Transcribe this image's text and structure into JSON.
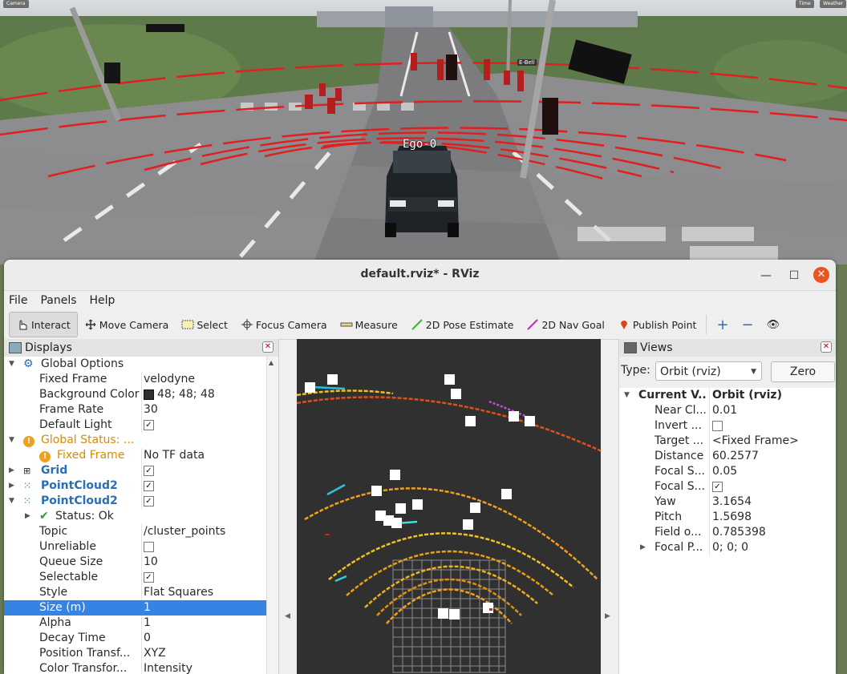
{
  "sim": {
    "tag_left": "Camera",
    "tag_right_1": "Time",
    "tag_right_2": "Weather",
    "ego_label": "Ego-0",
    "sign_label": "E-Bell"
  },
  "window": {
    "title": "default.rviz* - RViz",
    "minimize": "—",
    "maximize": "☐",
    "close": "✕"
  },
  "menu": {
    "file": "File",
    "panels": "Panels",
    "help": "Help"
  },
  "toolbar": {
    "interact": "Interact",
    "move_camera": "Move Camera",
    "select": "Select",
    "focus_camera": "Focus Camera",
    "measure": "Measure",
    "pose_estimate": "2D Pose Estimate",
    "nav_goal": "2D Nav Goal",
    "publish_point": "Publish Point",
    "add": "+",
    "remove": "−",
    "view": "👁"
  },
  "displays": {
    "title": "Displays",
    "rows": {
      "global_options": "Global Options",
      "fixed_frame_label": "Fixed Frame",
      "fixed_frame_value": "velodyne",
      "bg_color_label": "Background Color",
      "bg_color_value": "48; 48; 48",
      "frame_rate_label": "Frame Rate",
      "frame_rate_value": "30",
      "default_light_label": "Default Light",
      "global_status": "Global Status: ...",
      "gs_fixed_frame": "Fixed Frame",
      "gs_fixed_frame_value": "No TF data",
      "grid": "Grid",
      "pc1": "PointCloud2",
      "pc2": "PointCloud2",
      "status_ok": "Status: Ok",
      "topic_label": "Topic",
      "topic_value": "/cluster_points",
      "unreliable_label": "Unreliable",
      "queue_label": "Queue Size",
      "queue_value": "10",
      "selectable_label": "Selectable",
      "style_label": "Style",
      "style_value": "Flat Squares",
      "size_label": "Size (m)",
      "size_value": "1",
      "alpha_label": "Alpha",
      "alpha_value": "1",
      "decay_label": "Decay Time",
      "decay_value": "0",
      "pos_transf_label": "Position Transf...",
      "pos_transf_value": "XYZ",
      "color_transf_label": "Color Transfor...",
      "color_transf_value": "Intensity"
    }
  },
  "views": {
    "title": "Views",
    "type_label": "Type:",
    "type_value": "Orbit (rviz)",
    "zero_label": "Zero",
    "rows": {
      "current_label": "Current V...",
      "current_value": "Orbit (rviz)",
      "near_label": "Near Cl...",
      "near_value": "0.01",
      "invert_label": "Invert ...",
      "target_label": "Target ...",
      "target_value": "<Fixed Frame>",
      "distance_label": "Distance",
      "distance_value": "60.2577",
      "focal_s1_label": "Focal S...",
      "focal_s1_value": "0.05",
      "focal_s2_label": "Focal S...",
      "yaw_label": "Yaw",
      "yaw_value": "3.1654",
      "pitch_label": "Pitch",
      "pitch_value": "1.5698",
      "fov_label": "Field o...",
      "fov_value": "0.785398",
      "focal_p_label": "Focal P...",
      "focal_p_value": "0; 0; 0"
    }
  },
  "colors": {
    "accent": "#3584e4",
    "close_button": "#e95420",
    "view_bg": "#303030",
    "lidar_red": "#e02020"
  },
  "checkbox_mark": "✓"
}
